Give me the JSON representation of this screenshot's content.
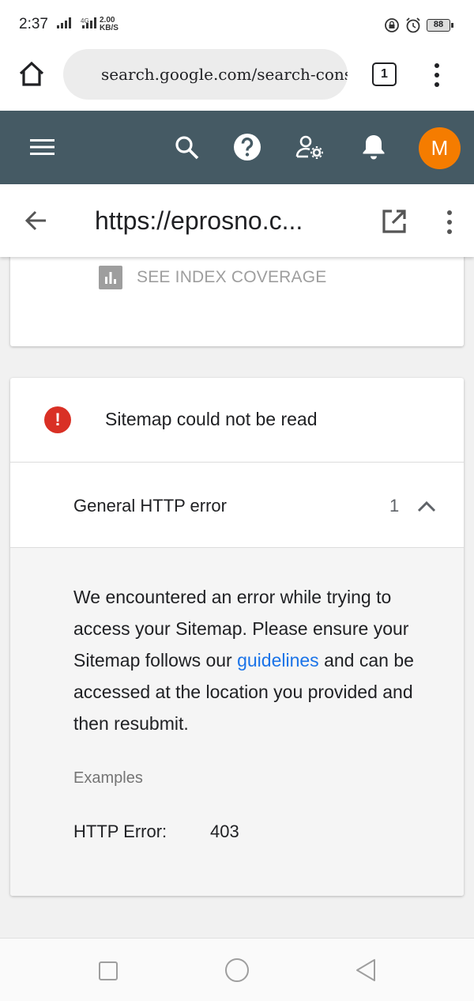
{
  "status_bar": {
    "time": "2:37",
    "network_type": "4G",
    "speed_value": "2.00",
    "speed_unit": "KB/S",
    "battery": "88"
  },
  "browser": {
    "url": "search.google.com/search-console",
    "tab_count": "1"
  },
  "toolbar": {
    "avatar_letter": "M",
    "avatar_color": "#f57c00",
    "bar_color": "#455a64"
  },
  "header": {
    "page_url": "https://eprosno.c..."
  },
  "card_top": {
    "see_index_label": "SEE INDEX COVERAGE"
  },
  "error_card": {
    "title": "Sitemap could not be read",
    "issue_label": "General HTTP error",
    "issue_count": "1",
    "description_before_link": "We encountered an error while trying to access your Sitemap. Please ensure your Sitemap follows our ",
    "link_text": "guidelines",
    "description_after_link": " and can be accessed at the location you provided and then resubmit.",
    "examples_label": "Examples",
    "example_key": "HTTP Error:",
    "example_value": "403",
    "error_color": "#d93025",
    "link_color": "#1a73e8"
  }
}
